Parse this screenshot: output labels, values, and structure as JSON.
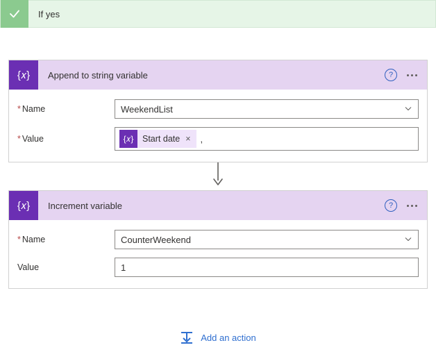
{
  "condition": {
    "title": "If yes"
  },
  "actions": [
    {
      "title": "Append to string variable",
      "icon": "fx-braces-icon",
      "fields": {
        "name": {
          "label": "Name",
          "required": true,
          "value": "WeekendList"
        },
        "value": {
          "label": "Value",
          "required": true,
          "tokens": [
            {
              "label": "Start date"
            }
          ],
          "trailing": ","
        }
      }
    },
    {
      "title": "Increment variable",
      "icon": "fx-braces-icon",
      "fields": {
        "name": {
          "label": "Name",
          "required": true,
          "value": "CounterWeekend"
        },
        "value": {
          "label": "Value",
          "required": false,
          "text": "1"
        }
      }
    }
  ],
  "add_action_label": "Add an action",
  "help_glyph": "?"
}
